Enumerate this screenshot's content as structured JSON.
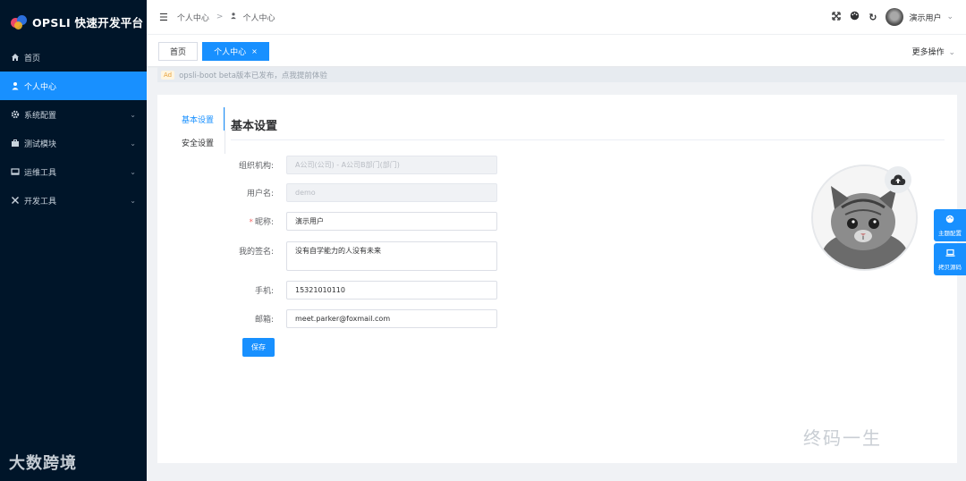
{
  "app": {
    "title": "OPSLI 快速开发平台"
  },
  "sidebar": {
    "items": [
      {
        "label": "首页",
        "icon": "home-icon"
      },
      {
        "label": "个人中心",
        "icon": "user-icon"
      },
      {
        "label": "系统配置",
        "icon": "gear-icon"
      },
      {
        "label": "测试模块",
        "icon": "briefcase-icon"
      },
      {
        "label": "运维工具",
        "icon": "monitor-icon"
      },
      {
        "label": "开发工具",
        "icon": "tools-icon"
      }
    ],
    "active_index": 1,
    "watermark": "大数跨境"
  },
  "header": {
    "breadcrumb": [
      "个人中心",
      "个人中心"
    ],
    "user_name": "演示用户"
  },
  "tabs": {
    "items": [
      {
        "label": "首页"
      },
      {
        "label": "个人中心"
      }
    ],
    "active_index": 1,
    "more": "更多操作"
  },
  "notice": {
    "tag": "Ad",
    "text": "opsli-boot beta版本已发布，点我提前体验"
  },
  "profile": {
    "side_tabs": [
      "基本设置",
      "安全设置"
    ],
    "title": "基本设置",
    "fields": {
      "org": {
        "label": "组织机构:",
        "value": "A公司(公司) - A公司B部门(部门)"
      },
      "username": {
        "label": "用户名:",
        "value": "demo"
      },
      "nickname": {
        "label": "昵称:",
        "value": "演示用户",
        "required": true
      },
      "signature": {
        "label": "我的签名:",
        "value": "没有自学能力的人没有未来"
      },
      "phone": {
        "label": "手机:",
        "value": "15321010110"
      },
      "email": {
        "label": "邮箱:",
        "value": "meet.parker@foxmail.com"
      }
    },
    "save": "保存",
    "watermark": "终码一生"
  },
  "float": [
    {
      "label": "主题配置"
    },
    {
      "label": "拷贝源码"
    }
  ],
  "colors": {
    "primary": "#1890ff",
    "sidebar_bg": "#001529",
    "required": "#f56c6c"
  }
}
